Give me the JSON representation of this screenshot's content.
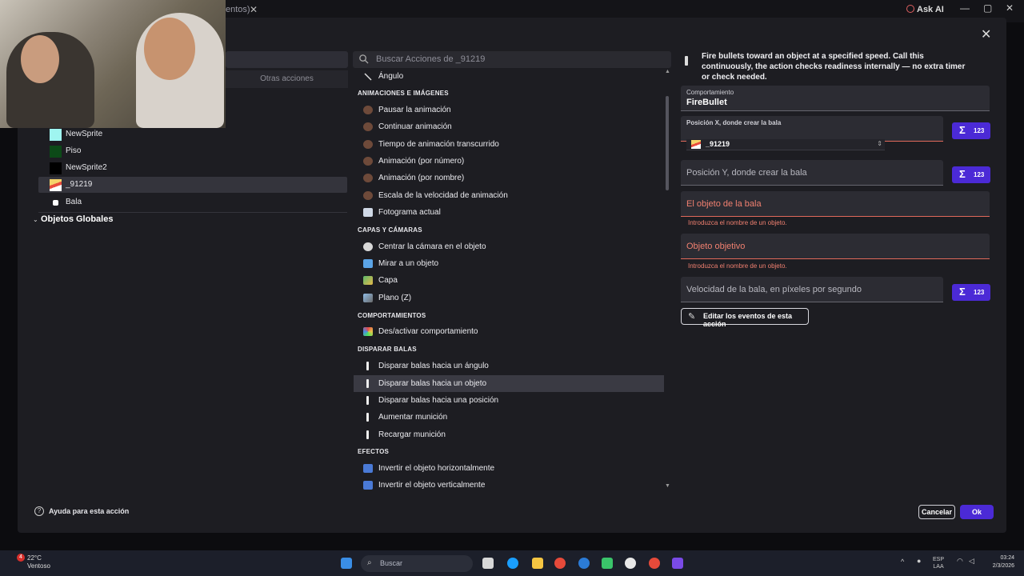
{
  "top_bar": {
    "tab_fragment": "entos)",
    "ask_ai": "Ask AI"
  },
  "left": {
    "otras_acciones": "Otras acciones",
    "objects": [
      {
        "label": "NewSprite",
        "color": "#9ff5f0"
      },
      {
        "label": "Piso",
        "color": "#0c4a18"
      },
      {
        "label": "NewSprite2",
        "color": "#000000"
      },
      {
        "label": "_91219",
        "color": "#e94c3c",
        "selected": true
      },
      {
        "label": "Bala",
        "color": "#ffffff"
      }
    ],
    "globals": "Objetos Globales"
  },
  "search": {
    "placeholder": "Buscar Acciones de _91219"
  },
  "actions": {
    "angulo": "Ángulo",
    "cat_anim": "ANIMACIONES E IMÁGENES",
    "pausar": "Pausar la animación",
    "continuar": "Continuar animación",
    "tiempo": "Tiempo de animación transcurrido",
    "anim_num": "Animación (por número)",
    "anim_nom": "Animación (por nombre)",
    "escala": "Escala de la velocidad de animación",
    "fotograma": "Fotograma actual",
    "cat_capas": "CAPAS Y CÁMARAS",
    "centrar": "Centrar la cámara en el objeto",
    "mirar": "Mirar a un objeto",
    "capa": "Capa",
    "plano": "Plano (Z)",
    "cat_comp": "COMPORTAMIENTOS",
    "desactivar": "Des/activar comportamiento",
    "cat_disparar": "DISPARAR BALAS",
    "angulo_b": "Disparar balas hacia un ángulo",
    "objeto_b": "Disparar balas hacia un objeto",
    "posicion_b": "Disparar balas hacia una posición",
    "aumentar": "Aumentar munición",
    "recargar": "Recargar munición",
    "cat_efectos": "EFECTOS",
    "inv_h": "Invertir el objeto horizontalmente",
    "inv_v": "Invertir el objeto verticalmente"
  },
  "right": {
    "description": "Fire bullets toward an object at a specified speed. Call this continuously, the action checks readiness internally — no extra timer or check needed.",
    "comportamiento_label": "Comportamiento",
    "comportamiento_value": "FireBullet",
    "posx_label": "Posición X, donde crear la bala",
    "autocomplete_value": "_91219",
    "posy_placeholder": "Posición Y, donde crear la bala",
    "objeto_placeholder": "El objeto de la bala",
    "objeto_error": "Introduzca el nombre de un objeto.",
    "objetivo_placeholder": "Objeto objetivo",
    "objetivo_error": "Introduzca el nombre de un objeto.",
    "velocidad_placeholder": "Velocidad de la bala, en píxeles por segundo",
    "sigma_num": "123",
    "edit_events": "Editar los eventos de esta acción"
  },
  "footer": {
    "help": "Ayuda para esta acción",
    "cancel": "Cancelar",
    "ok": "Ok"
  },
  "taskbar": {
    "temp": "22°C",
    "weather": "Ventoso",
    "badge": "4",
    "search": "Buscar",
    "lang1": "ESP",
    "lang2": "LAA",
    "time": "03:24",
    "date": "2/3/2026"
  },
  "colors": {
    "accent": "#4b2ad6",
    "error": "#e0695a",
    "dialog_bg": "#1d1d22"
  }
}
